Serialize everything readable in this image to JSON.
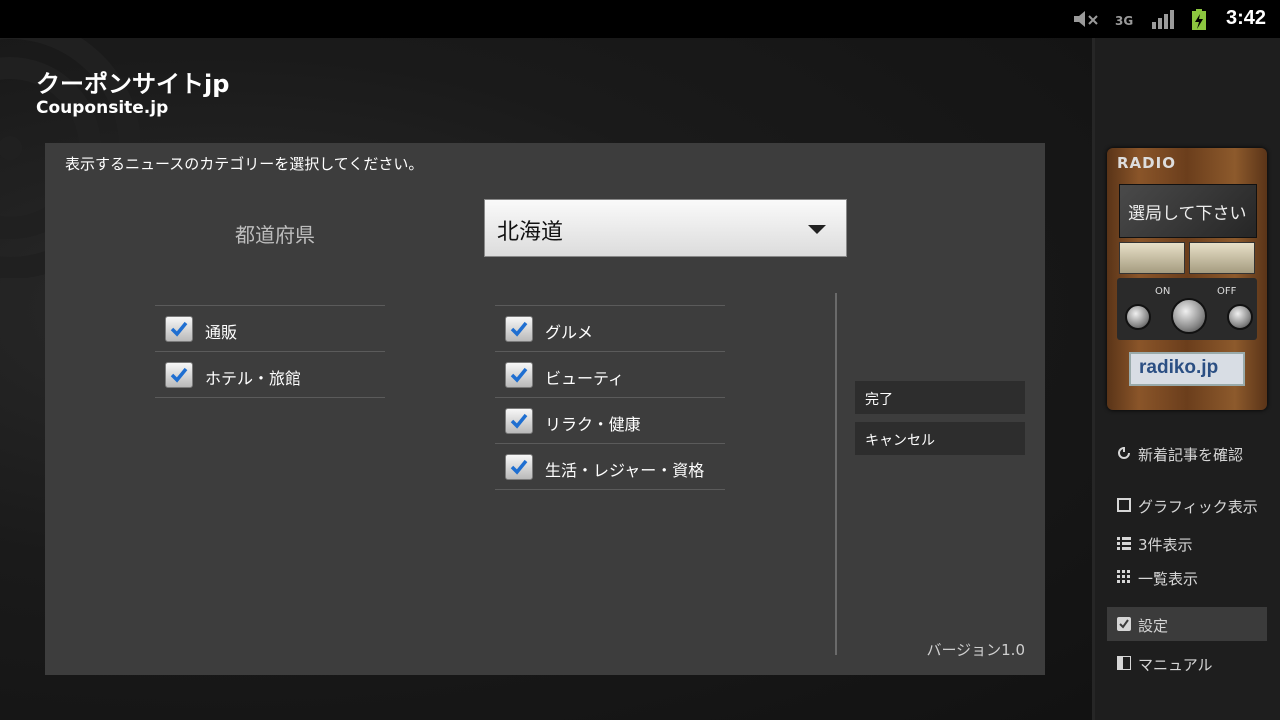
{
  "status_bar": {
    "time": "3:42",
    "icons": [
      "volume-muted-icon",
      "3g-icon",
      "signal-icon",
      "battery-charging-icon"
    ]
  },
  "app": {
    "title": "クーポンサイトjp",
    "subtitle": "Couponsite.jp"
  },
  "settings": {
    "instruction": "表示するニュースのカテゴリーを選択してください。",
    "prefecture_label": "都道府県",
    "prefecture_value": "北海道",
    "categories_left": [
      {
        "label": "通販",
        "checked": true
      },
      {
        "label": "ホテル・旅館",
        "checked": true
      }
    ],
    "categories_right": [
      {
        "label": "グルメ",
        "checked": true
      },
      {
        "label": "ビューティ",
        "checked": true
      },
      {
        "label": "リラク・健康",
        "checked": true
      },
      {
        "label": "生活・レジャー・資格",
        "checked": true
      }
    ],
    "done_label": "完了",
    "cancel_label": "キャンセル",
    "version": "バージョン1.0"
  },
  "radio": {
    "title": "RADIO",
    "display_text": "選局して下さい",
    "on_label": "ON",
    "off_label": "OFF",
    "brand": "radiko.jp"
  },
  "sidebar_menu": [
    {
      "label": "新着記事を確認",
      "icon": "refresh-icon",
      "active": false
    },
    {
      "label": "グラフィック表示",
      "icon": "square-icon",
      "active": false
    },
    {
      "label": "3件表示",
      "icon": "list-icon",
      "active": false
    },
    {
      "label": "一覧表示",
      "icon": "grid-icon",
      "active": false
    },
    {
      "label": "設定",
      "icon": "checkbox-icon",
      "active": true
    },
    {
      "label": "マニュアル",
      "icon": "book-icon",
      "active": false
    }
  ],
  "colors": {
    "check_blue": "#1f6fd1",
    "panel_bg": "#3d3d3d"
  }
}
